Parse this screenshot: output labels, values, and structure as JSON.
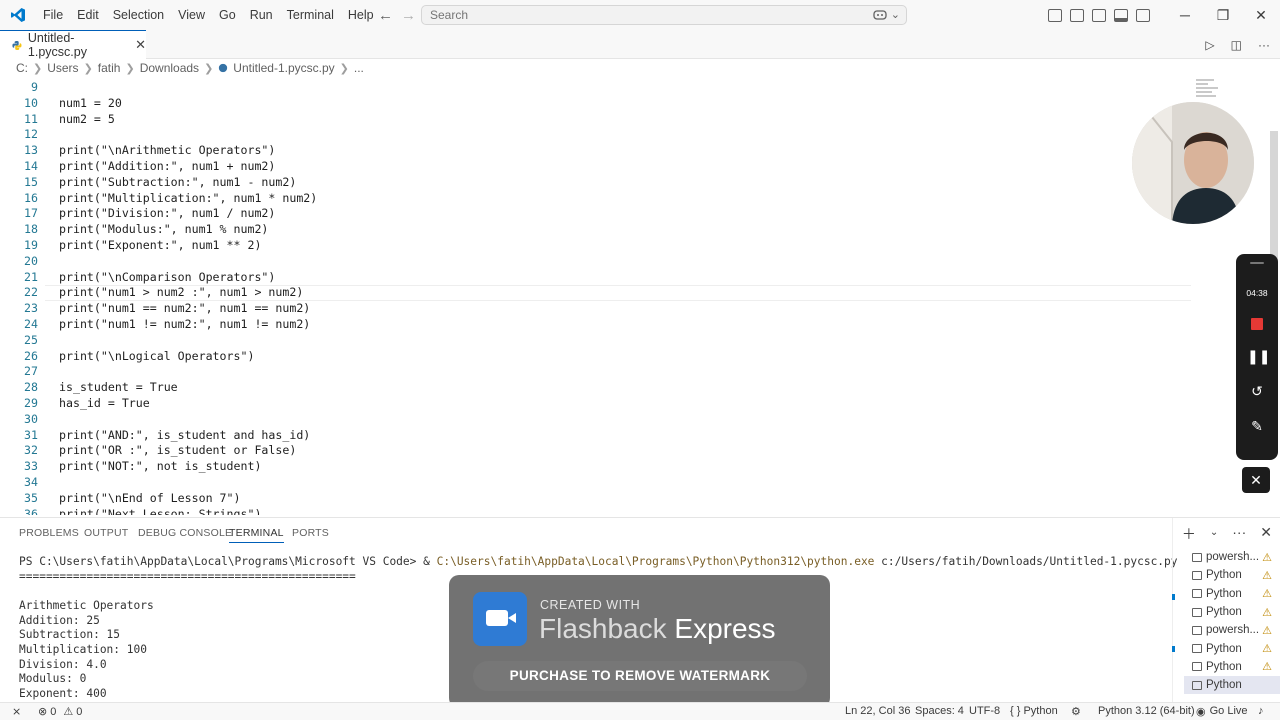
{
  "menu": [
    "File",
    "Edit",
    "Selection",
    "View",
    "Go",
    "Run",
    "Terminal",
    "Help"
  ],
  "search": {
    "placeholder": "Search"
  },
  "tab": {
    "label": "Untitled-1.pycsc.py",
    "close": "✕"
  },
  "breadcrumb": [
    "C:",
    "Users",
    "fatih",
    "Downloads",
    "Untitled-1.pycsc.py",
    "..."
  ],
  "code_lines": [
    {
      "n": "9",
      "t": ""
    },
    {
      "n": "10",
      "t": "num1 = 20"
    },
    {
      "n": "11",
      "t": "num2 = 5"
    },
    {
      "n": "12",
      "t": ""
    },
    {
      "n": "13",
      "t": "print(\"\\nArithmetic Operators\")"
    },
    {
      "n": "14",
      "t": "print(\"Addition:\", num1 + num2)"
    },
    {
      "n": "15",
      "t": "print(\"Subtraction:\", num1 - num2)"
    },
    {
      "n": "16",
      "t": "print(\"Multiplication:\", num1 * num2)"
    },
    {
      "n": "17",
      "t": "print(\"Division:\", num1 / num2)"
    },
    {
      "n": "18",
      "t": "print(\"Modulus:\", num1 % num2)"
    },
    {
      "n": "19",
      "t": "print(\"Exponent:\", num1 ** 2)"
    },
    {
      "n": "20",
      "t": ""
    },
    {
      "n": "21",
      "t": "print(\"\\nComparison Operators\")"
    },
    {
      "n": "22",
      "t": "print(\"num1 > num2 :\", num1 > num2)"
    },
    {
      "n": "23",
      "t": "print(\"num1 == num2:\", num1 == num2)"
    },
    {
      "n": "24",
      "t": "print(\"num1 != num2:\", num1 != num2)"
    },
    {
      "n": "25",
      "t": ""
    },
    {
      "n": "26",
      "t": "print(\"\\nLogical Operators\")"
    },
    {
      "n": "27",
      "t": ""
    },
    {
      "n": "28",
      "t": "is_student = True"
    },
    {
      "n": "29",
      "t": "has_id = True"
    },
    {
      "n": "30",
      "t": ""
    },
    {
      "n": "31",
      "t": "print(\"AND:\", is_student and has_id)"
    },
    {
      "n": "32",
      "t": "print(\"OR :\", is_student or False)"
    },
    {
      "n": "33",
      "t": "print(\"NOT:\", not is_student)"
    },
    {
      "n": "34",
      "t": ""
    },
    {
      "n": "35",
      "t": "print(\"\\nEnd of Lesson 7\")"
    },
    {
      "n": "36",
      "t": "print(\"Next Lesson: Strings\")"
    }
  ],
  "recorder": {
    "time": "04:38"
  },
  "panel_tabs": [
    "PROBLEMS",
    "OUTPUT",
    "DEBUG CONSOLE",
    "TERMINAL",
    "PORTS"
  ],
  "terminal": {
    "prompt": "PS C:\\Users\\fatih\\AppData\\Local\\Programs\\Microsoft VS Code> & ",
    "exe": "C:\\Users\\fatih\\AppData\\Local\\Programs\\Python\\Python312\\python.exe",
    "arg": " c:/Users/fatih/Downloads/Untitled-1.pycsc.py",
    "lines": [
      "==================================================",
      "",
      "Arithmetic Operators",
      "Addition: 25",
      "Subtraction: 15",
      "Multiplication: 100",
      "Division: 4.0",
      "Modulus: 0",
      "Exponent: 400"
    ]
  },
  "terminal_list": [
    "powersh...",
    "Python",
    "Python",
    "Python",
    "powersh...",
    "Python",
    "Python",
    "Python"
  ],
  "watermark": {
    "created": "CREATED WITH",
    "brand_a": "Flashback ",
    "brand_b": "Express",
    "button": "PURCHASE TO REMOVE WATERMARK"
  },
  "status": {
    "errors": "0",
    "warnings": "0",
    "position": "Ln 22, Col 36",
    "spaces": "Spaces: 4",
    "encoding": "UTF-8",
    "language": "{ } Python",
    "interpreter": "Python 3.12 (64-bit)",
    "golive": "Go Live"
  },
  "colors": {
    "accent": "#005fb8",
    "line_number": "#237893",
    "record": "#e53935"
  }
}
